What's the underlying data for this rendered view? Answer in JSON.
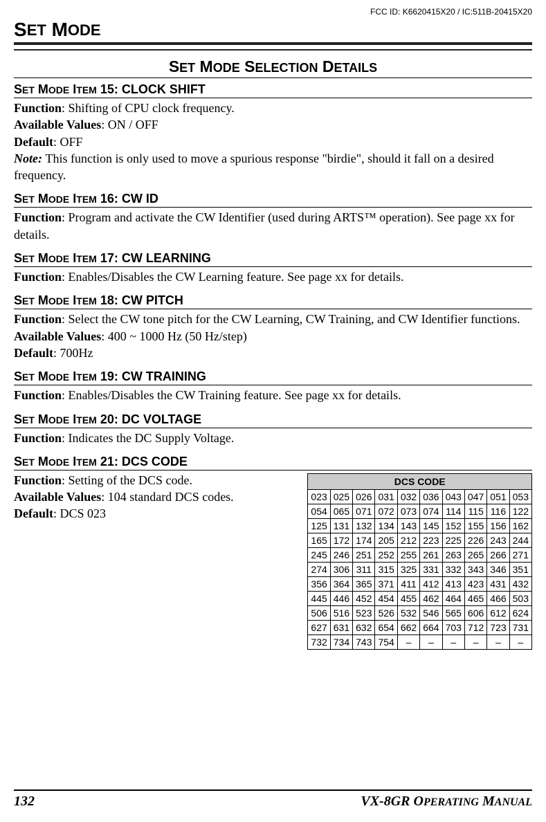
{
  "fcc": "FCC ID: K6620415X20 / IC:511B-20415X20",
  "page_title_main": "S",
  "page_title_rest_1": "ET",
  "page_title_space": " M",
  "page_title_rest_2": "ODE",
  "section_title_parts": {
    "p1": "S",
    "p2": "ET",
    "p3": " M",
    "p4": "ODE",
    "p5": " S",
    "p6": "ELECTION",
    "p7": " D",
    "p8": "ETAILS"
  },
  "items": [
    {
      "heading_html": {
        "p1": "S",
        "p2": "ET",
        "p3": " M",
        "p4": "ODE",
        "p5": " I",
        "p6": "TEM",
        "rest": " 15: CLOCK SHIFT"
      },
      "lines": [
        {
          "label": "Function",
          "text": ": Shifting of CPU clock frequency."
        },
        {
          "label": "Available Values",
          "text": ": ON / OFF"
        },
        {
          "label": "Default",
          "text": ": OFF"
        }
      ],
      "note": "This function is only used to move a spurious response \"birdie\", should it fall on a desired frequency."
    },
    {
      "heading_html": {
        "p1": "S",
        "p2": "ET",
        "p3": " M",
        "p4": "ODE",
        "p5": " I",
        "p6": "TEM",
        "rest": " 16: CW ID"
      },
      "lines": [
        {
          "label": "Function",
          "text": ": Program and activate the CW Identifier (used during ARTS™ operation). See page xx for details."
        }
      ]
    },
    {
      "heading_html": {
        "p1": "S",
        "p2": "ET",
        "p3": " M",
        "p4": "ODE",
        "p5": " I",
        "p6": "TEM",
        "rest": " 17: CW LEARNING"
      },
      "lines": [
        {
          "label": "Function",
          "text": ": Enables/Disables the CW Learning feature. See page xx for details."
        }
      ]
    },
    {
      "heading_html": {
        "p1": "S",
        "p2": "ET",
        "p3": " M",
        "p4": "ODE",
        "p5": " I",
        "p6": "TEM",
        "rest": " 18: CW PITCH"
      },
      "lines": [
        {
          "label": "Function",
          "text": ": Select the CW tone pitch for the CW Learning, CW Training, and CW Identifier functions."
        },
        {
          "label": "Available Values",
          "text": ": 400 ~ 1000 Hz (50 Hz/step)"
        },
        {
          "label": "Default",
          "text": ": 700Hz"
        }
      ]
    },
    {
      "heading_html": {
        "p1": "S",
        "p2": "ET",
        "p3": " M",
        "p4": "ODE",
        "p5": " I",
        "p6": "TEM",
        "rest": " 19: CW TRAINING"
      },
      "lines": [
        {
          "label": "Function",
          "text": ": Enables/Disables the CW Training feature. See page xx for details."
        }
      ]
    },
    {
      "heading_html": {
        "p1": "S",
        "p2": "ET",
        "p3": " M",
        "p4": "ODE",
        "p5": " I",
        "p6": "TEM",
        "rest": " 20: DC VOLTAGE"
      },
      "lines": [
        {
          "label": "Function",
          "text": ": Indicates the DC Supply Voltage."
        }
      ]
    },
    {
      "heading_html": {
        "p1": "S",
        "p2": "ET",
        "p3": " M",
        "p4": "ODE",
        "p5": " I",
        "p6": "TEM",
        "rest": " 21: DCS CODE"
      },
      "lines": [
        {
          "label": "Function",
          "text": ": Setting of the DCS code."
        },
        {
          "label": "Available Values",
          "text": ": 104 standard DCS codes."
        },
        {
          "label": "Default",
          "text": ": DCS 023"
        }
      ]
    }
  ],
  "dcs": {
    "header": "DCS CODE",
    "rows": [
      [
        "023",
        "025",
        "026",
        "031",
        "032",
        "036",
        "043",
        "047",
        "051",
        "053"
      ],
      [
        "054",
        "065",
        "071",
        "072",
        "073",
        "074",
        "114",
        "115",
        "116",
        "122"
      ],
      [
        "125",
        "131",
        "132",
        "134",
        "143",
        "145",
        "152",
        "155",
        "156",
        "162"
      ],
      [
        "165",
        "172",
        "174",
        "205",
        "212",
        "223",
        "225",
        "226",
        "243",
        "244"
      ],
      [
        "245",
        "246",
        "251",
        "252",
        "255",
        "261",
        "263",
        "265",
        "266",
        "271"
      ],
      [
        "274",
        "306",
        "311",
        "315",
        "325",
        "331",
        "332",
        "343",
        "346",
        "351"
      ],
      [
        "356",
        "364",
        "365",
        "371",
        "411",
        "412",
        "413",
        "423",
        "431",
        "432"
      ],
      [
        "445",
        "446",
        "452",
        "454",
        "455",
        "462",
        "464",
        "465",
        "466",
        "503"
      ],
      [
        "506",
        "516",
        "523",
        "526",
        "532",
        "546",
        "565",
        "606",
        "612",
        "624"
      ],
      [
        "627",
        "631",
        "632",
        "654",
        "662",
        "664",
        "703",
        "712",
        "723",
        "731"
      ],
      [
        "732",
        "734",
        "743",
        "754",
        "–",
        "–",
        "–",
        "–",
        "–",
        "–"
      ]
    ]
  },
  "footer": {
    "page": "132",
    "manual_parts": {
      "p1": "VX-8GR O",
      "p2": "PERATING",
      "p3": " M",
      "p4": "ANUAL"
    }
  }
}
